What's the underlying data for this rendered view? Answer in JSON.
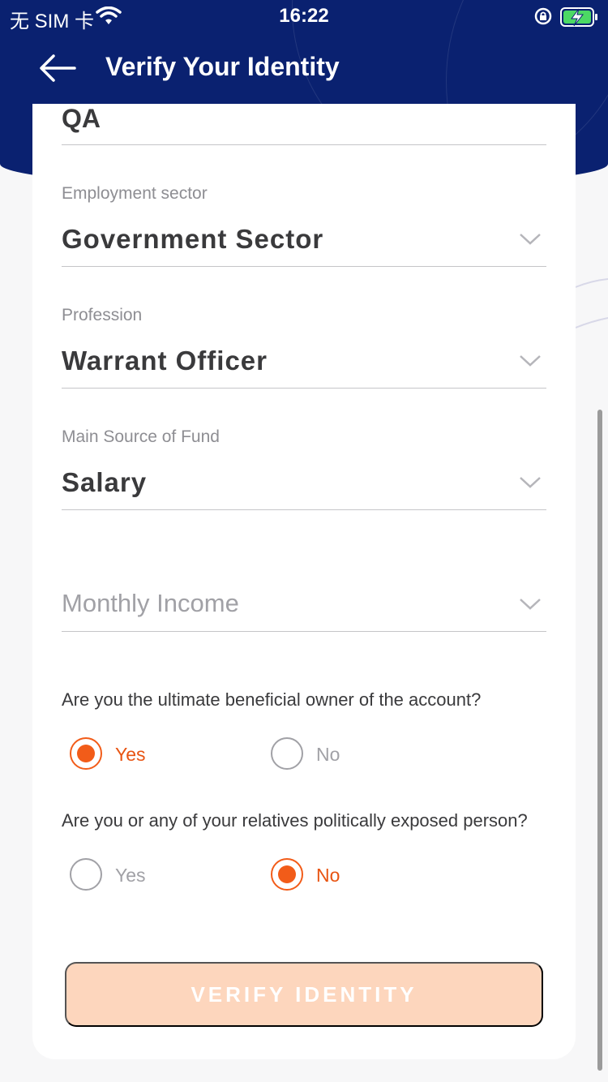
{
  "status_bar": {
    "carrier": "无 SIM 卡",
    "time": "16:22"
  },
  "header": {
    "title": "Verify Your Identity"
  },
  "form": {
    "previous_value": "QA",
    "employment_sector": {
      "label": "Employment sector",
      "value": "Government Sector"
    },
    "profession": {
      "label": "Profession",
      "value": "Warrant Officer"
    },
    "source_of_fund": {
      "label": "Main Source of Fund",
      "value": "Salary"
    },
    "monthly_income": {
      "placeholder": "Monthly Income"
    },
    "beneficial_owner": {
      "question": "Are you the ultimate beneficial owner of the account?",
      "yes_label": "Yes",
      "no_label": "No",
      "selected": "Yes"
    },
    "politically_exposed": {
      "question": "Are you or any of your relatives politically exposed person?",
      "yes_label": "Yes",
      "no_label": "No",
      "selected": "No"
    },
    "submit_label": "VERIFY IDENTITY"
  },
  "colors": {
    "header_bg": "#0a2170",
    "accent": "#f25c19",
    "button_disabled_bg": "#fdd6bd"
  },
  "icons": {
    "back": "arrow-left-icon",
    "dropdown": "chevron-down-icon",
    "wifi": "wifi-icon",
    "lock": "rotation-lock-icon",
    "battery": "battery-charging-icon"
  }
}
